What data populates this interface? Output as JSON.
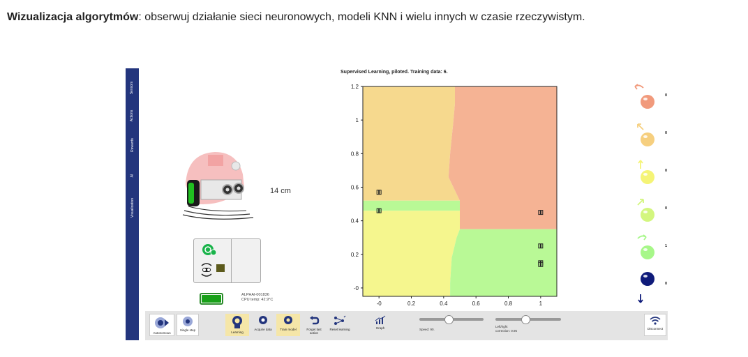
{
  "headline": {
    "bold": "Wizualizacja algorytmów",
    "rest": ": obserwuj działanie sieci neuronowych, modeli KNN i wielu innych w czasie rzeczywistym."
  },
  "sidebar": {
    "tabs": [
      {
        "label": "Sensors"
      },
      {
        "label": "Actions"
      },
      {
        "label": "Rewards"
      },
      {
        "label": "AI"
      },
      {
        "label": "Visualization"
      }
    ]
  },
  "robot": {
    "distance": "14 cm",
    "device_id": "ALPHAI-001836",
    "cpu_temp": "CPU temp: 42.9°C",
    "battery_level": 1.0
  },
  "chart": {
    "title": "Supervised Learning, piloted. Training data: 6.",
    "colors": {
      "orange": "#f5b394",
      "yellow_orange": "#f6d98e",
      "yellow": "#f5f68e",
      "green": "#b9f996"
    }
  },
  "chart_data": {
    "type": "heatmap",
    "title": "Supervised Learning, piloted. Training data: 6.",
    "xlim": [
      -0.1,
      1.1
    ],
    "ylim": [
      -0.05,
      1.2
    ],
    "xticks": [
      "-0",
      "0.2",
      "0.4",
      "0.6",
      "0.8",
      "1"
    ],
    "yticks": [
      "-0",
      "0.2",
      "0.4",
      "0.6",
      "0.8",
      "1",
      "1.2"
    ],
    "xtick_values": [
      0,
      0.2,
      0.4,
      0.6,
      0.8,
      1
    ],
    "ytick_values": [
      0,
      0.2,
      0.4,
      0.6,
      0.8,
      1,
      1.2
    ],
    "regions": [
      {
        "class": "yellow_orange",
        "polygon": [
          [
            -0.1,
            1.2
          ],
          [
            0.47,
            1.2
          ],
          [
            0.47,
            1.1
          ],
          [
            0.46,
            0.99
          ],
          [
            0.44,
            0.8
          ],
          [
            0.43,
            0.66
          ],
          [
            0.5,
            0.52
          ],
          [
            -0.1,
            0.52
          ]
        ]
      },
      {
        "class": "orange",
        "polygon": [
          [
            0.47,
            1.2
          ],
          [
            1.1,
            1.2
          ],
          [
            1.1,
            0.35
          ],
          [
            0.5,
            0.35
          ],
          [
            0.5,
            0.52
          ],
          [
            0.43,
            0.66
          ],
          [
            0.44,
            0.8
          ],
          [
            0.46,
            0.99
          ],
          [
            0.47,
            1.1
          ]
        ]
      },
      {
        "class": "green",
        "polygon": [
          [
            -0.1,
            0.52
          ],
          [
            0.5,
            0.52
          ],
          [
            0.5,
            0.46
          ],
          [
            -0.1,
            0.46
          ]
        ]
      },
      {
        "class": "yellow",
        "polygon": [
          [
            -0.1,
            0.46
          ],
          [
            0.5,
            0.46
          ],
          [
            0.5,
            0.35
          ],
          [
            0.48,
            0.3
          ],
          [
            0.45,
            0.18
          ],
          [
            0.44,
            0.03
          ],
          [
            0.44,
            -0.05
          ],
          [
            -0.1,
            -0.05
          ]
        ]
      },
      {
        "class": "green",
        "polygon": [
          [
            0.5,
            0.35
          ],
          [
            1.1,
            0.35
          ],
          [
            1.1,
            -0.05
          ],
          [
            0.44,
            -0.05
          ],
          [
            0.44,
            0.03
          ],
          [
            0.45,
            0.18
          ],
          [
            0.48,
            0.3
          ]
        ]
      }
    ],
    "points": [
      {
        "x": 0,
        "y": 0.57,
        "class": "yellow_orange"
      },
      {
        "x": 0,
        "y": 0.46,
        "class": "green"
      },
      {
        "x": 1,
        "y": 0.45,
        "class": "orange"
      },
      {
        "x": 1,
        "y": 0.25,
        "class": "green"
      },
      {
        "x": 1,
        "y": 0.15,
        "class": "green"
      },
      {
        "x": 1,
        "y": 0.14,
        "class": "green"
      }
    ]
  },
  "actions": [
    {
      "name": "turn-left-back",
      "count": "0",
      "color": "#f19a7c",
      "arrow": "back-left"
    },
    {
      "name": "turn-left",
      "count": "0",
      "color": "#f6cf7f",
      "arrow": "up-left"
    },
    {
      "name": "forward",
      "count": "0",
      "color": "#f5f476",
      "arrow": "up"
    },
    {
      "name": "turn-right",
      "count": "0",
      "color": "#d3f67f",
      "arrow": "up-right"
    },
    {
      "name": "turn-right-back",
      "count": "1",
      "color": "#a7f789",
      "arrow": "back-right"
    },
    {
      "name": "backward",
      "count": "0",
      "color": "#0f1b7a",
      "arrow": "down"
    }
  ],
  "toolbar": {
    "autonomous": "Autonomous",
    "single_step": "Single step",
    "learning": "Learning",
    "acquire_data": "Acquire data",
    "train_model": "Train model",
    "forget_last_action": "Forget last action",
    "reset_learning": "Reset learning",
    "graph": "Graph",
    "speed_label": "Speed: 90.",
    "speed_value": 0.45,
    "lr_label_1": "Left/right",
    "lr_label_2": "correction: 0.95",
    "lr_value": 0.45,
    "disconnect": "Disconnect"
  }
}
